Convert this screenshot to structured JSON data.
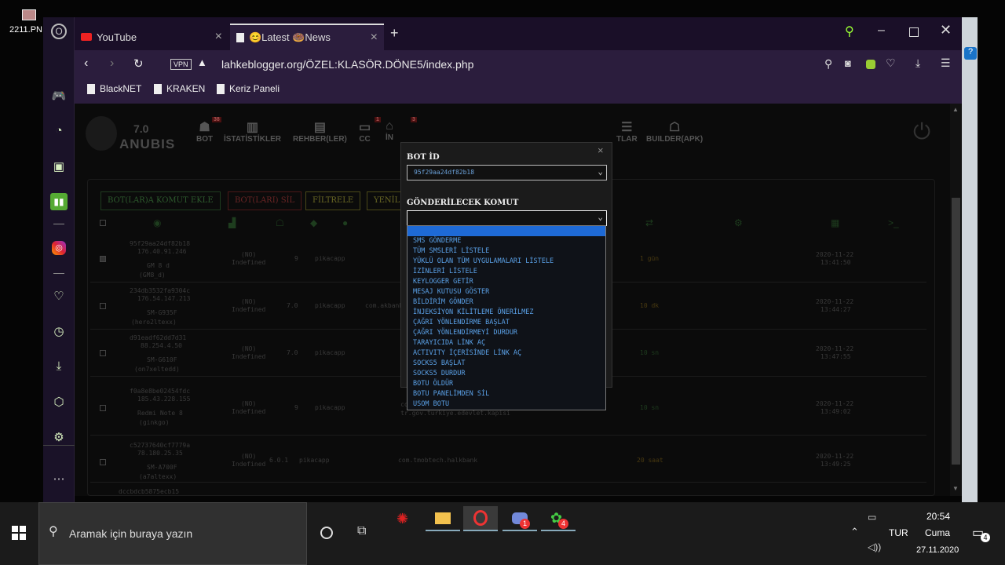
{
  "desktop": {
    "file_label": "2211.PN"
  },
  "browser": {
    "tabs": [
      {
        "label": "YouTube",
        "icon": "youtube-icon"
      },
      {
        "label": "😊Latest 🍩News",
        "icon": "page-icon"
      }
    ],
    "vpn_badge": "VPN",
    "url": "lahkeblogger.org/ÖZEL:KLASÖR.DÖNE5/index.php",
    "bookmarks": [
      "BlackNET",
      "KRAKEN",
      "Keriz Paneli"
    ]
  },
  "site": {
    "logo_version": "7.0",
    "logo_name": "ANUBIS",
    "nav": [
      {
        "label": "BOT",
        "badge": "38"
      },
      {
        "label": "İSTATİSTİKLER",
        "badge": ""
      },
      {
        "label": "REHBER(LER)",
        "badge": ""
      },
      {
        "label": "CC",
        "badge": "1"
      },
      {
        "label": "İN",
        "badge": "3"
      },
      {
        "label": "TLAR",
        "badge": ""
      },
      {
        "label": "BUILDER(APK)",
        "badge": ""
      }
    ],
    "buttons": [
      "BOT(LAR)A KOMUT EKLE",
      "BOT(LARI) SİL",
      "FİLTRELE",
      "YENİL"
    ],
    "rows": [
      {
        "id": "95f29aa24df82b18",
        "ip": "176.40.91.246",
        "model": "GM 8 d",
        "model2": "(GM8_d)",
        "lang": "(NO)",
        "loc": "Indefined",
        "ver": "9",
        "tag": "pikacapp",
        "apps": "",
        "last": "1 gün",
        "date": "2020-11-22",
        "time": "13:41:50"
      },
      {
        "id": "234db3532fa9304c",
        "ip": "176.54.147.213",
        "model": "SM-G935F",
        "model2": "(hero2ltexx)",
        "lang": "(NO)",
        "loc": "Indefined",
        "ver": "7.0",
        "tag": "pikacapp",
        "apps": "com.akbank... tr.go...",
        "last": "10 dk",
        "date": "2020-11-22",
        "time": "13:44:27"
      },
      {
        "id": "d91eadf62dd7d31",
        "ip": "88.254.4.50",
        "model": "SM-G610F",
        "model2": "(on7xeltedd)",
        "lang": "(NO)",
        "loc": "Indefined",
        "ver": "7.0",
        "tag": "pikacapp",
        "apps": "",
        "last": "10 sn",
        "date": "2020-11-22",
        "time": "13:47:55"
      },
      {
        "id": "f0a8e8be02454fdc",
        "ip": "185.43.228.155",
        "model": "Redmi Note 8",
        "model2": "(ginkgo)",
        "lang": "(NO)",
        "loc": "Indefined",
        "ver": "9",
        "tag": "pikacapp",
        "apps": "com.akbank... com.ykb.android tr.gov.turkiye.edevlet.kapisi",
        "last": "10 sn",
        "date": "2020-11-22",
        "time": "13:49:02"
      },
      {
        "id": "c52737640cf7779a",
        "ip": "78.180.25.35",
        "model": "SM-A700F",
        "model2": "(a7altexx)",
        "lang": "(NO)",
        "loc": "Indefined",
        "ver": "6.0.1",
        "tag": "pikacapp",
        "apps": "com.tmobtech.halkbank",
        "last": "20 saat",
        "date": "2020-11-22",
        "time": "13:49:25"
      }
    ],
    "last_row_partial": "dccbdcb5875ecb15"
  },
  "modal": {
    "close": "×",
    "bot_id_label": "BOT İD",
    "bot_id_value": "95f29aa24df82b18",
    "command_label": "GÖNDERİLECEK KOMUT",
    "command_value": "",
    "options": [
      "SMS GÖNDERME",
      "TÜM SMSLERİ LİSTELE",
      "YÜKLÜ OLAN TÜM UYGULAMALARI LİSTELE",
      "İZİNLERİ LİSTELE",
      "KEYLOGGER GETİR",
      "MESAJ KUTUSU GÖSTER",
      "BİLDİRİM GÖNDER",
      "İNJEKSİYON KİLİTLEME ÖNERİLMEZ",
      "ÇAĞRI YÖNLENDİRME BAŞLAT",
      "ÇAĞRI YÖNLENDİRMEYİ DURDUR",
      "TARAYICIDA LİNK AÇ",
      "ACTIVITY İÇERİSİNDE LİNK AÇ",
      "SOCKS5 BAŞLAT",
      "SOCKS5 DURDUR",
      "BOTU ÖLDÜR",
      "BOTU PANELİMDEN SİL",
      "USOM BOTU"
    ]
  },
  "taskbar": {
    "search_placeholder": "Aramak için buraya yazın",
    "lang": "TUR",
    "time": "20:54",
    "day": "Cuma",
    "date": "27.11.2020",
    "discord_badge": "1",
    "app_badge": "4",
    "notif_badge": "4"
  }
}
